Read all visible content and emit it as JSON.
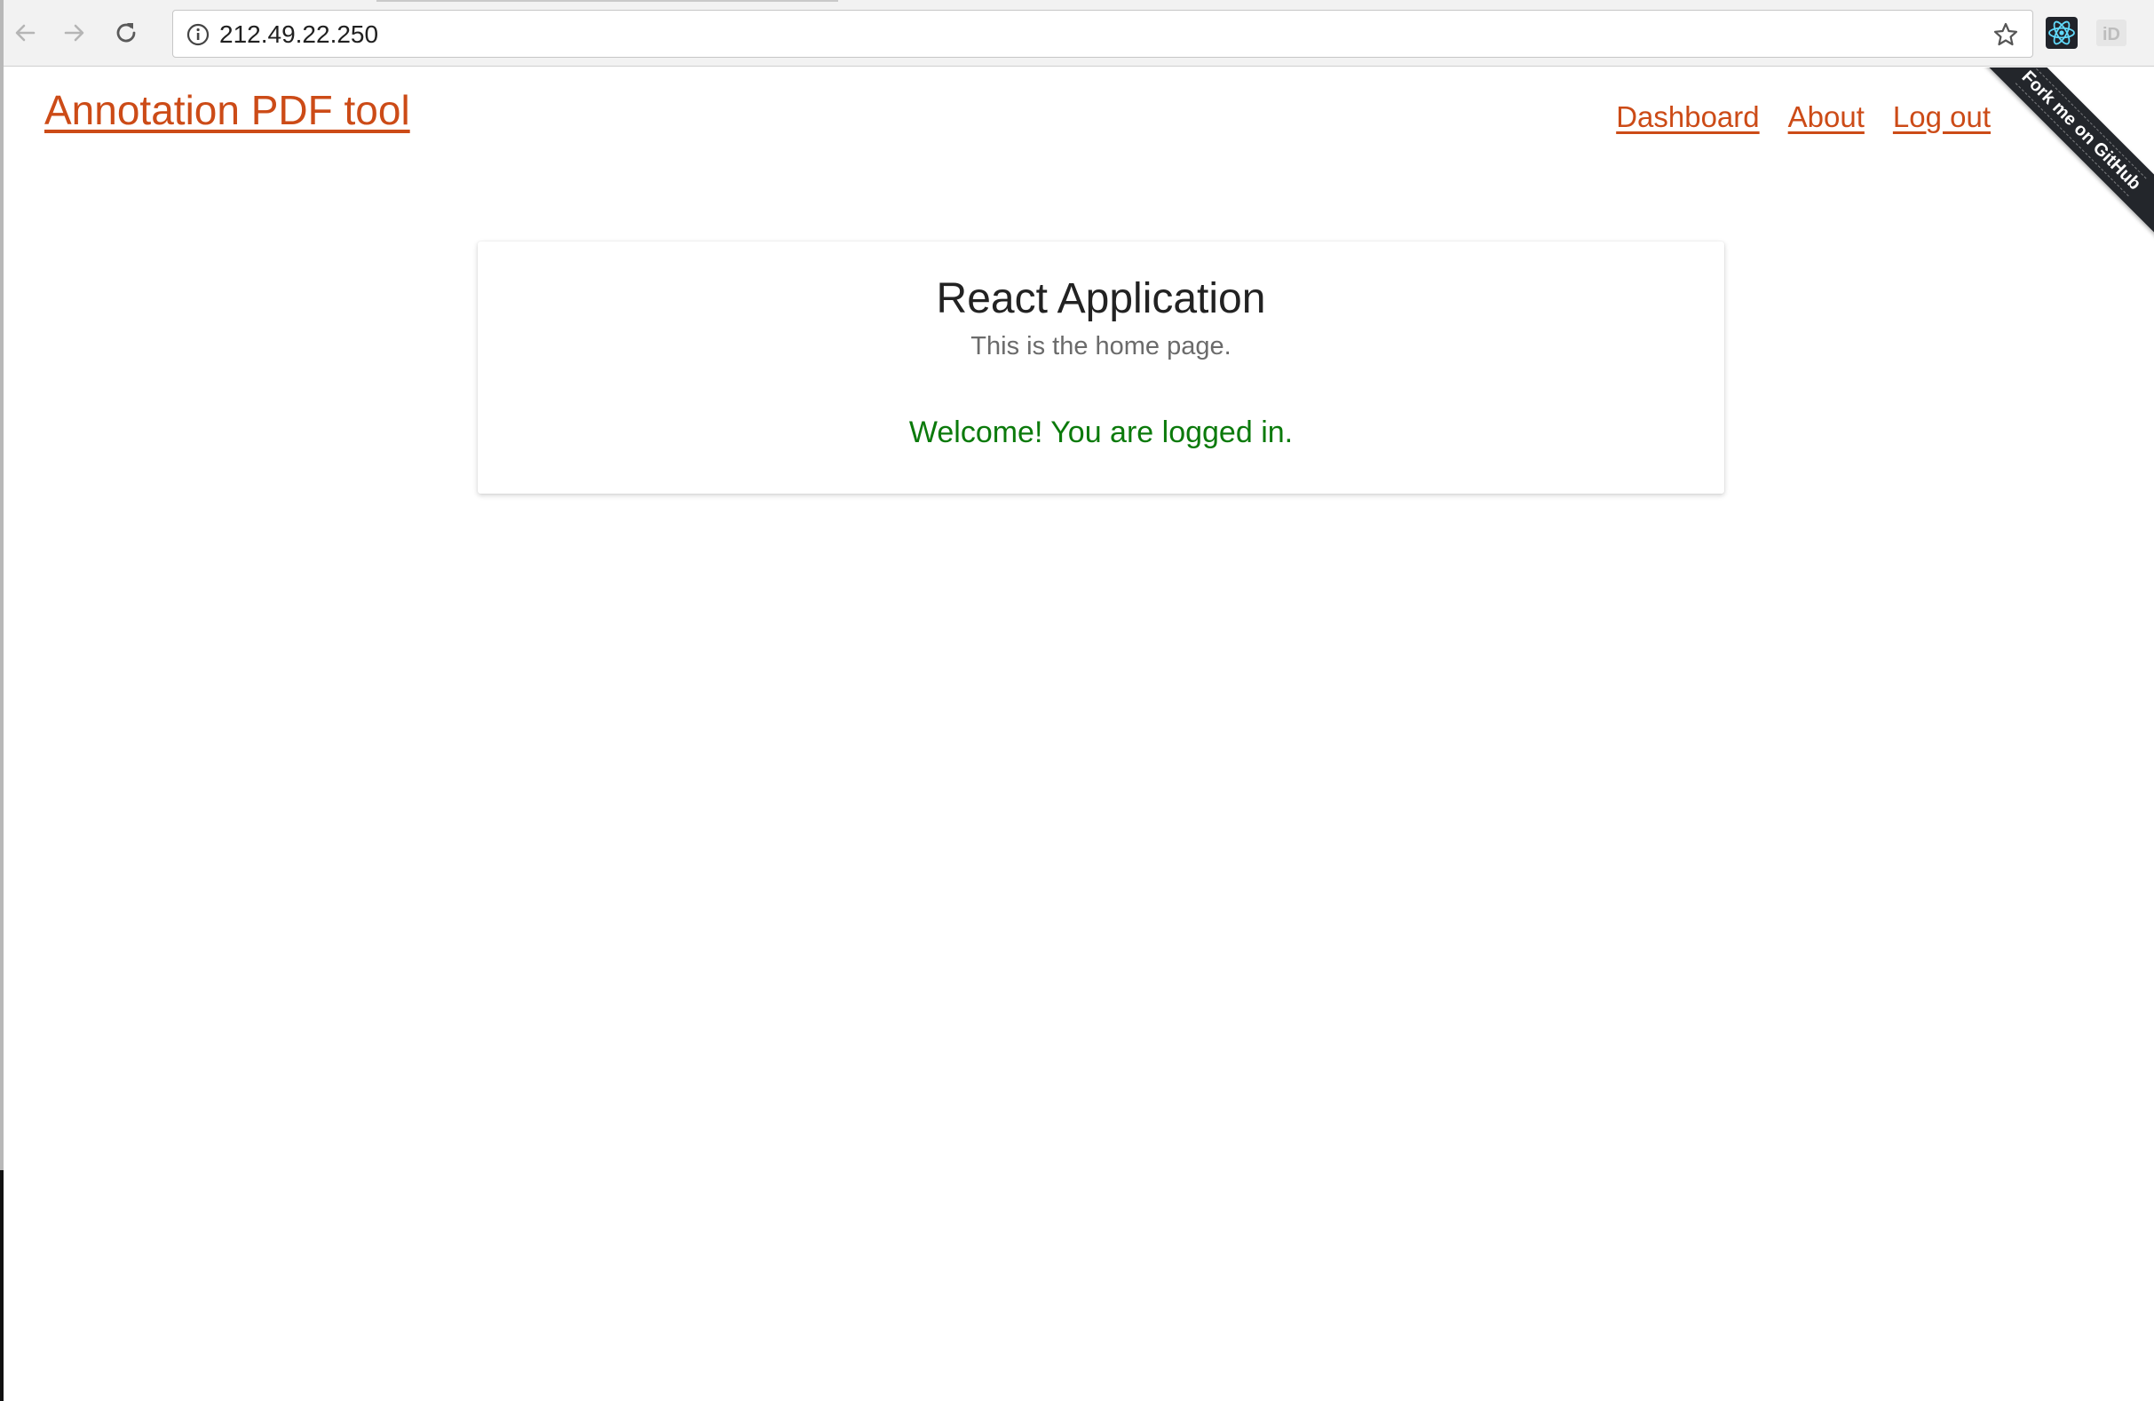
{
  "browser": {
    "url": "212.49.22.250",
    "icons": {
      "back": "arrow-left-icon",
      "forward": "arrow-right-icon",
      "reload": "reload-icon",
      "site_info": "info-icon",
      "bookmark": "star-icon",
      "ext_react": "react-devtools-icon",
      "ext_id": "id-extension-icon"
    },
    "ext_id_label": "iD"
  },
  "header": {
    "site_title": "Annotation PDF tool",
    "nav": [
      {
        "label": "Dashboard"
      },
      {
        "label": "About"
      },
      {
        "label": "Log out"
      }
    ],
    "ribbon_label": "Fork me on GitHub"
  },
  "card": {
    "title": "React Application",
    "subtitle": "This is the home page.",
    "welcome": "Welcome! You are logged in."
  },
  "colors": {
    "link": "#cc4b17",
    "welcome": "#0b7a0b",
    "ribbon": "#23262b",
    "react": "#61dafb"
  }
}
